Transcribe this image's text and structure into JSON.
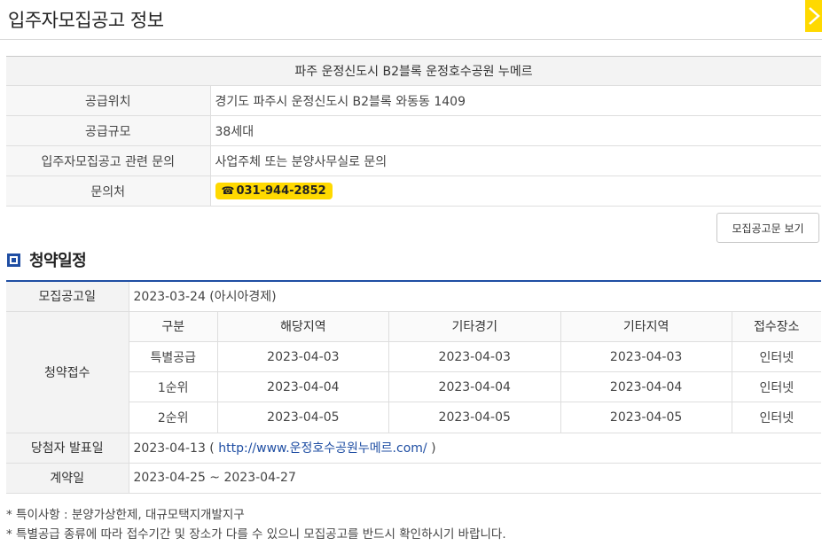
{
  "header": {
    "title": "입주자모집공고 정보"
  },
  "info": {
    "caption": "파주 운정신도시 B2블록 운정호수공원 누메르",
    "rows": [
      {
        "label": "공급위치",
        "value": "경기도 파주시 운정신도시 B2블록 와동동 1409"
      },
      {
        "label": "공급규모",
        "value": "38세대"
      },
      {
        "label": "입주자모집공고 관련 문의",
        "value": "사업주체 또는 분양사무실로 문의"
      },
      {
        "label": "문의처",
        "phone": "031-944-2852"
      }
    ]
  },
  "notice_button_label": "모집공고문 보기",
  "schedule": {
    "title": "청약일정",
    "announce_label": "모집공고일",
    "announce_value": "2023-03-24 (아시아경제)",
    "apply_label": "청약접수",
    "columns": [
      "구분",
      "해당지역",
      "기타경기",
      "기타지역",
      "접수장소"
    ],
    "rows": [
      [
        "특별공급",
        "2023-04-03",
        "2023-04-03",
        "2023-04-03",
        "인터넷"
      ],
      [
        "1순위",
        "2023-04-04",
        "2023-04-04",
        "2023-04-04",
        "인터넷"
      ],
      [
        "2순위",
        "2023-04-05",
        "2023-04-05",
        "2023-04-05",
        "인터넷"
      ]
    ],
    "winner_label": "당첨자 발표일",
    "winner_date": "2023-04-13 (",
    "winner_link": "http://www.운정호수공원누메르.com/",
    "winner_suffix": " )",
    "contract_label": "계약일",
    "contract_value": "2023-04-25 ~ 2023-04-27"
  },
  "footnotes": [
    "* 특이사항 : 분양가상한제, 대규모택지개발지구",
    "* 특별공급 종류에 따라 접수기간 및 장소가 다를 수 있으니 모집공고를 반드시 확인하시기 바랍니다."
  ],
  "colors": {
    "accent": "#1f4ea3",
    "highlight": "#ffd900"
  }
}
